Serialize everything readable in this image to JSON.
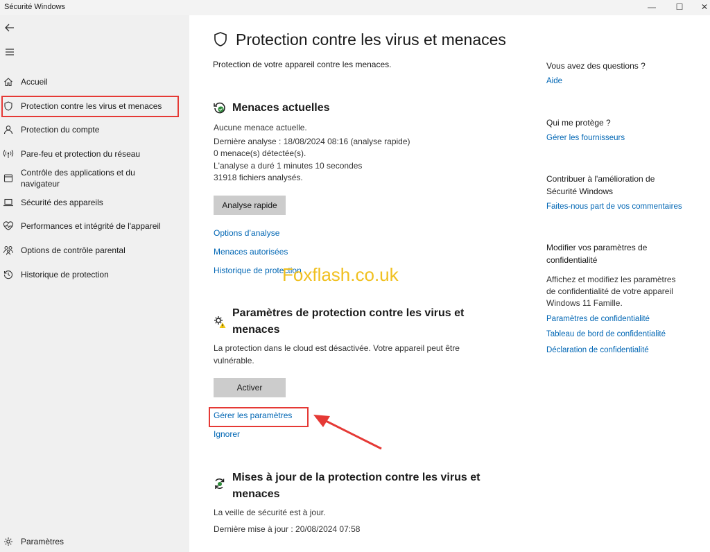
{
  "window": {
    "title": "Sécurité Windows",
    "controls": {
      "minimize": "—",
      "maximize": "☐",
      "close": "✕"
    }
  },
  "sidebar": {
    "items": [
      {
        "label": "Accueil",
        "icon": "home-icon"
      },
      {
        "label": "Protection contre les virus et menaces",
        "icon": "shield-icon",
        "selected": true
      },
      {
        "label": "Protection du compte",
        "icon": "person-icon"
      },
      {
        "label": "Pare-feu et protection du réseau",
        "icon": "antenna-icon"
      },
      {
        "label": "Contrôle des applications et du navigateur",
        "icon": "browser-window-icon"
      },
      {
        "label": "Sécurité des appareils",
        "icon": "laptop-icon"
      },
      {
        "label": "Performances et intégrité de l'appareil",
        "icon": "heart-pulse-icon"
      },
      {
        "label": "Options de contrôle parental",
        "icon": "family-icon"
      },
      {
        "label": "Historique de protection",
        "icon": "history-icon"
      }
    ],
    "settings_label": "Paramètres"
  },
  "main": {
    "title": "Protection contre les virus et menaces",
    "subtitle": "Protection de votre appareil contre les menaces.",
    "current_threats": {
      "title": "Menaces actuelles",
      "lines": [
        "Aucune menace actuelle.",
        "Dernière analyse : 18/08/2024 08:16 (analyse rapide)",
        "0 menace(s) détectée(s).",
        "L'analyse a duré 1 minutes 10 secondes",
        "31918 fichiers analysés."
      ],
      "button": "Analyse rapide",
      "links": [
        "Options d’analyse",
        "Menaces autorisées",
        "Historique de protection"
      ]
    },
    "protection_settings": {
      "title_line1": "Paramètres de protection contre les virus et",
      "title_line2": "menaces",
      "text_line1": "La protection dans le cloud est désactivée. Votre appareil peut être",
      "text_line2": "vulnérable.",
      "button": "Activer",
      "manage_link": "Gérer les paramètres",
      "ignore_link": "Ignorer"
    },
    "updates": {
      "title_line1": "Mises à jour de la protection contre les virus et",
      "title_line2": "menaces",
      "line1": "La veille de sécurité est à jour.",
      "line2": "Dernière mise à jour : 20/08/2024 07:58"
    }
  },
  "right_panel": {
    "questions": {
      "heading": "Vous avez des questions ?",
      "link": "Aide"
    },
    "who_protects": {
      "heading": "Qui me protège ?",
      "link": "Gérer les fournisseurs"
    },
    "contribute": {
      "heading_line1": "Contribuer à l'amélioration de",
      "heading_line2": "Sécurité Windows",
      "link": "Faites-nous part de vos commentaires"
    },
    "privacy": {
      "heading_line1": "Modifier vos paramètres de",
      "heading_line2": "confidentialité",
      "text_line1": "Affichez et modifiez les paramètres",
      "text_line2": "de confidentialité de votre appareil",
      "text_line3": "Windows 11 Famille.",
      "links": [
        "Paramètres de confidentialité",
        "Tableau de bord de confidentialité",
        "Déclaration de confidentialité"
      ]
    }
  },
  "watermark": "Foxflash.co.uk",
  "colors": {
    "link": "#0066b4",
    "highlight": "#e53935",
    "sidebar_bg": "#f0f0f0",
    "watermark": "#f0c020"
  }
}
